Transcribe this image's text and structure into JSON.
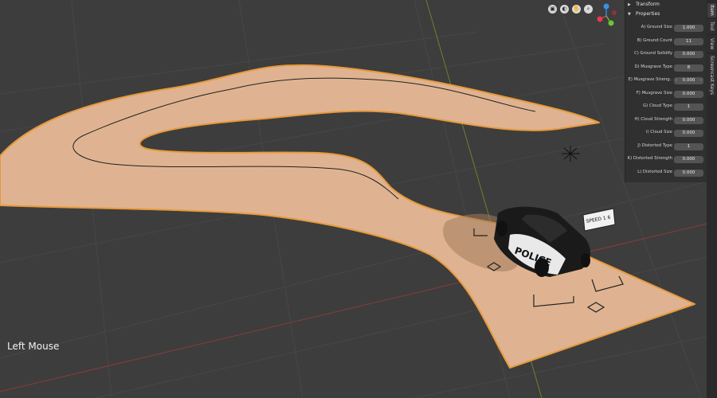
{
  "screencast": {
    "last_input": "Left Mouse"
  },
  "nav_gizmo": {
    "buttons": [
      "camera-icon",
      "view-icon",
      "hand-icon",
      "zoom-icon"
    ],
    "axis_labels": {
      "x": "X",
      "y": "Y",
      "z": "Z"
    },
    "colors": {
      "x": "#e8384f",
      "y": "#6ec234",
      "z": "#3b8fe8"
    }
  },
  "sidebar": {
    "sections": [
      {
        "label": "Transform",
        "collapsed": true
      },
      {
        "label": "Properties",
        "collapsed": false
      }
    ],
    "properties": [
      {
        "label": "A) Ground Size",
        "value": "1.000"
      },
      {
        "label": "B) Ground Count",
        "value": "11"
      },
      {
        "label": "C) Ground Solidify",
        "value": "0.000"
      },
      {
        "label": "D) Musgrave Type",
        "value": "8"
      },
      {
        "label": "E) Musgrave Streng..",
        "value": "0.000",
        "stepper": true
      },
      {
        "label": "F) Musgrave Size",
        "value": "0.000"
      },
      {
        "label": "G) Cloud  Type",
        "value": "1"
      },
      {
        "label": "H) Cloud  Strength",
        "value": "0.000"
      },
      {
        "label": "I) Cloud  Size",
        "value": "0.000"
      },
      {
        "label": "J) Distorted Type",
        "value": "1"
      },
      {
        "label": "K) Distorted Strength",
        "value": "0.000"
      },
      {
        "label": "L) Distorted Size",
        "value": "0.000"
      }
    ],
    "tabs": [
      "Item",
      "Tool",
      "View",
      "Screencast Keys"
    ],
    "active_tab": "Item"
  },
  "scene": {
    "car_text": "POLICE",
    "sign_text": "SPEED 1 6"
  }
}
